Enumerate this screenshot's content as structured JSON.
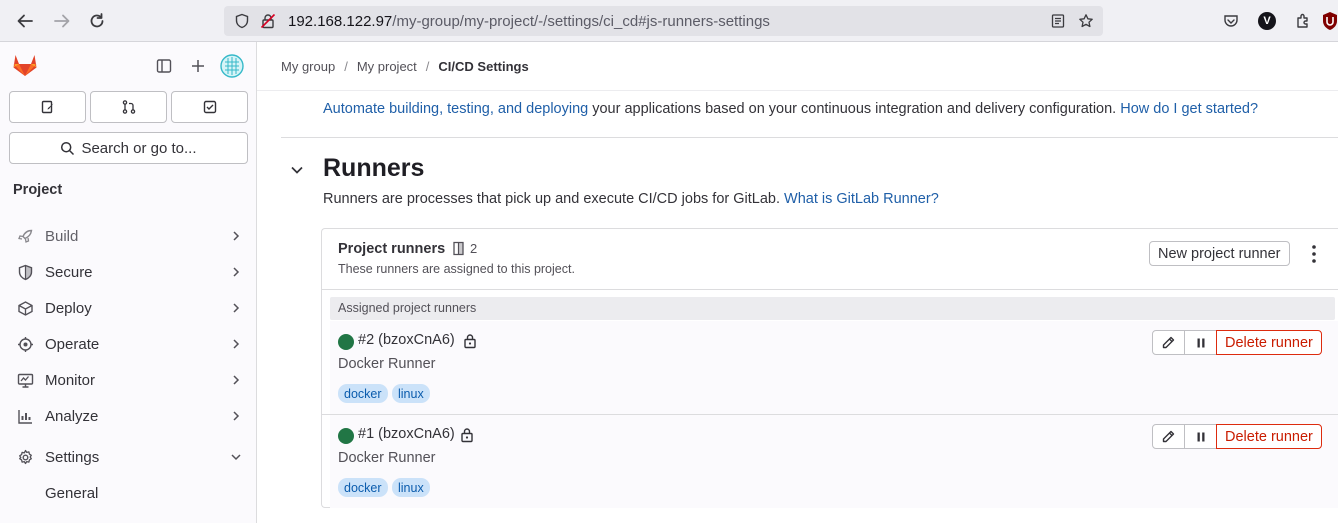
{
  "browser": {
    "url_host": "192.168.122.97",
    "url_path": "/my-group/my-project/-/settings/ci_cd#js-runners-settings",
    "profile_initial": "V"
  },
  "sidebar": {
    "search_label": "Search or go to...",
    "section_title": "Project",
    "items": [
      {
        "label": "Build",
        "icon": "rocket-icon"
      },
      {
        "label": "Secure",
        "icon": "shield-icon"
      },
      {
        "label": "Deploy",
        "icon": "deploy-icon"
      },
      {
        "label": "Operate",
        "icon": "cloud-icon"
      },
      {
        "label": "Monitor",
        "icon": "monitor-icon"
      },
      {
        "label": "Analyze",
        "icon": "chart-icon"
      },
      {
        "label": "Settings",
        "icon": "gear-icon"
      },
      {
        "label": "General"
      }
    ]
  },
  "breadcrumbs": [
    "My group",
    "My project",
    "CI/CD Settings"
  ],
  "intro": {
    "link1": "Automate building, testing, and deploying",
    "text": " your applications based on your continuous integration and delivery configuration. ",
    "link2": "How do I get started?"
  },
  "runners": {
    "title": "Runners",
    "description": "Runners are processes that pick up and execute CI/CD jobs for GitLab. ",
    "description_link": "What is GitLab Runner?",
    "card_title": "Project runners",
    "count": "2",
    "card_subtitle": "These runners are assigned to this project.",
    "new_button": "New project runner",
    "assigned_label": "Assigned project runners",
    "list": [
      {
        "name": "#2 (bzoxCnA6)",
        "description": "Docker Runner",
        "tags": [
          "docker",
          "linux"
        ],
        "delete_label": "Delete runner"
      },
      {
        "name": "#1 (bzoxCnA6)",
        "description": "Docker Runner",
        "tags": [
          "docker",
          "linux"
        ],
        "delete_label": "Delete runner"
      }
    ]
  },
  "colors": {
    "status_online": "#217645",
    "link": "#1f5fa8",
    "danger": "#dd2b0e",
    "tag_bg": "#cbe2f9"
  }
}
